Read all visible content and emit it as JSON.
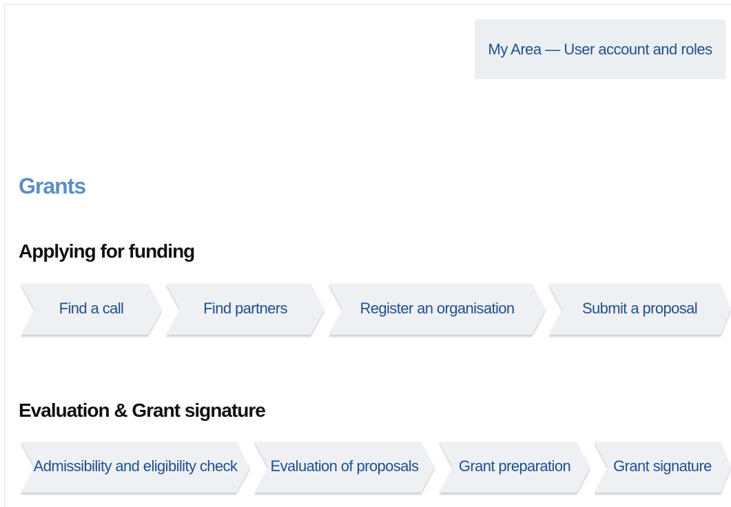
{
  "header": {
    "my_area_label": "My Area — User account and roles"
  },
  "grants": {
    "title": "Grants",
    "groups": [
      {
        "title": "Applying for funding",
        "steps": [
          {
            "label": "Find a call"
          },
          {
            "label": "Find partners"
          },
          {
            "label": "Register an organisation"
          },
          {
            "label": "Submit a proposal"
          }
        ]
      },
      {
        "title": "Evaluation & Grant signature",
        "steps": [
          {
            "label": "Admissibility and eligibility check"
          },
          {
            "label": "Evaluation of proposals"
          },
          {
            "label": "Grant preparation"
          },
          {
            "label": "Grant signature"
          }
        ]
      }
    ]
  },
  "colors": {
    "step_fill": "#eef0f3",
    "link_text": "#1f4f8f",
    "section_title": "#5b8fc7"
  }
}
